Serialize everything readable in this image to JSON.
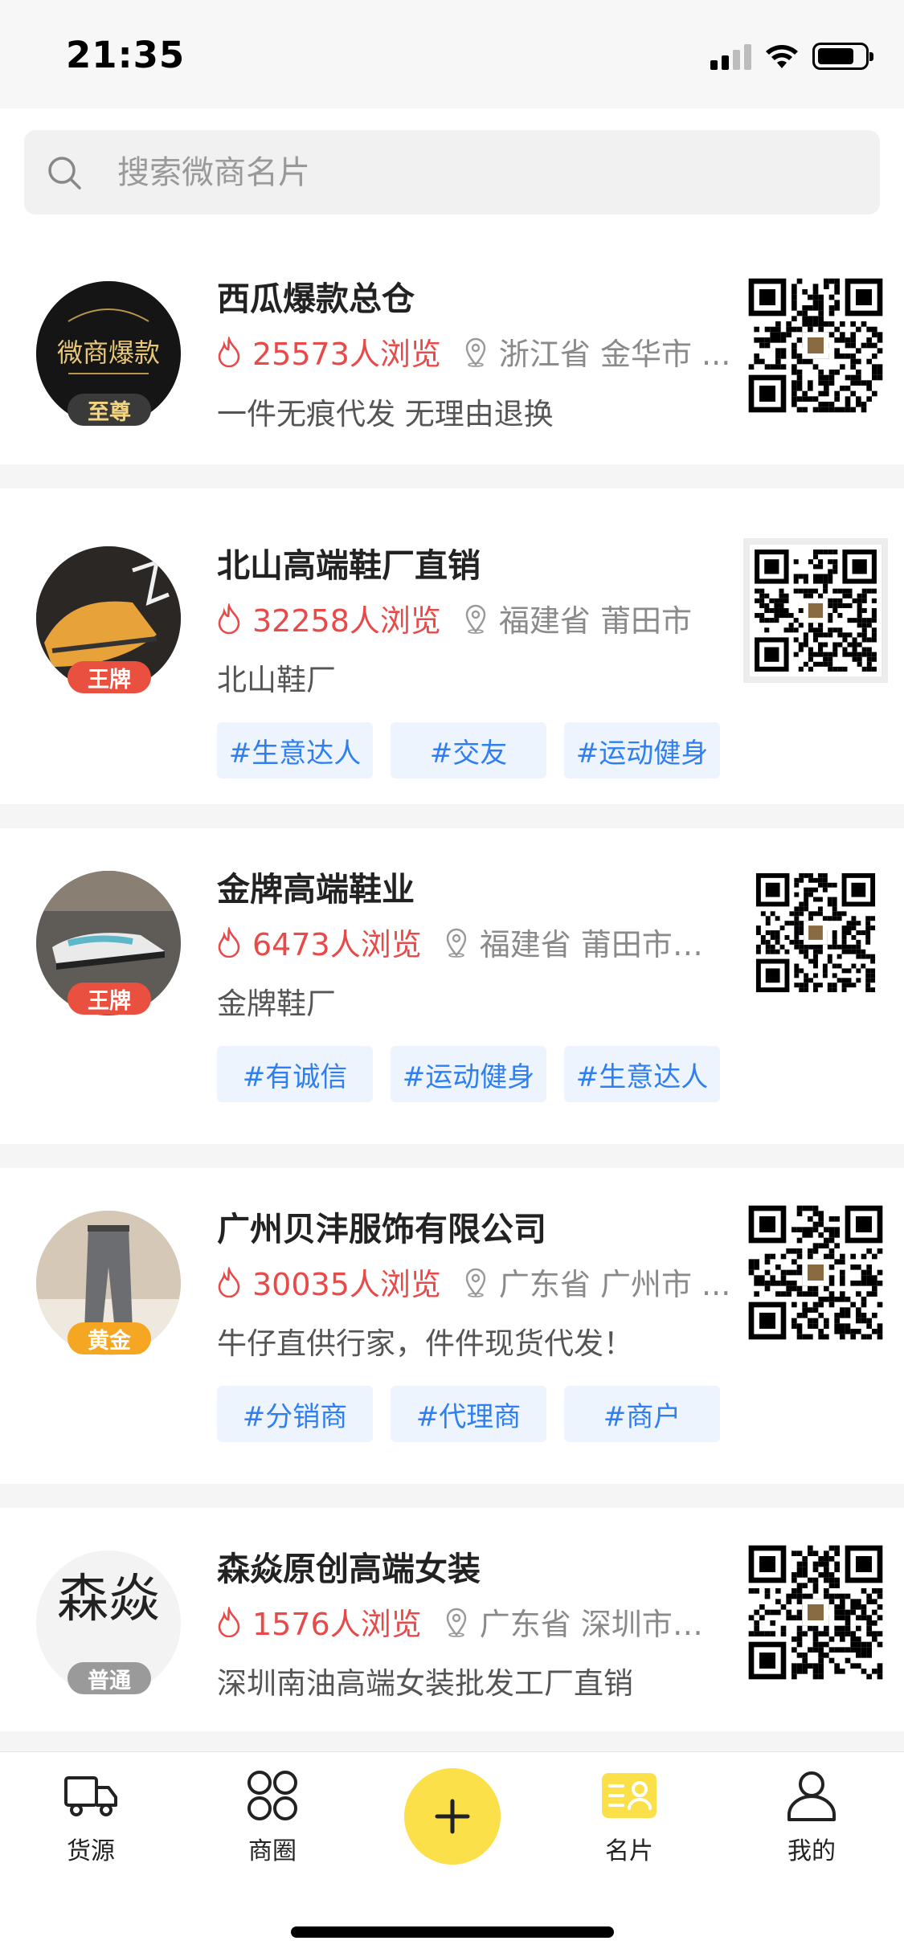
{
  "status": {
    "time": "21:35"
  },
  "search": {
    "placeholder": "搜索微商名片"
  },
  "cards": [
    {
      "name": "西瓜爆款总仓",
      "views": "25573人浏览",
      "location": "浙江省 金华市 ...",
      "desc": "一件无痕代发 无理由退换",
      "badge": "至尊",
      "avatar_text": "微商爆款",
      "tags": []
    },
    {
      "name": "北山高端鞋厂直销",
      "views": "32258人浏览",
      "location": "福建省 莆田市",
      "desc": "北山鞋厂",
      "badge": "王牌",
      "tags": [
        "#生意达人",
        "#交友",
        "#运动健身"
      ]
    },
    {
      "name": "金牌高端鞋业",
      "views": "6473人浏览",
      "location": "福建省 莆田市 ...",
      "desc": "金牌鞋厂",
      "badge": "王牌",
      "tags": [
        "#有诚信",
        "#运动健身",
        "#生意达人"
      ]
    },
    {
      "name": "广州贝沣服饰有限公司",
      "views": "30035人浏览",
      "location": "广东省 广州市 ...",
      "desc": "牛仔直供行家，件件现货代发！",
      "badge": "黄金",
      "tags": [
        "#分销商",
        "#代理商",
        "#商户"
      ]
    },
    {
      "name": "森焱原创高端女装",
      "views": "1576人浏览",
      "location": "广东省 深圳市 ...",
      "desc": "深圳南油高端女装批发工厂直销",
      "badge": "普通",
      "avatar_text": "森焱",
      "tags": []
    }
  ],
  "tabbar": {
    "items": [
      {
        "label": "货源",
        "icon": "truck-icon"
      },
      {
        "label": "商圈",
        "icon": "grid-icon"
      },
      {
        "label": "名片",
        "icon": "card-icon"
      },
      {
        "label": "我的",
        "icon": "user-icon"
      }
    ],
    "add_icon": "plus-icon"
  },
  "colors": {
    "accent_yellow": "#fbe04a",
    "views_red": "#e84a4a",
    "tag_blue": "#2f7ff0",
    "badge_zhizun": "#3a3a3a",
    "badge_wangpai": "#e9503f",
    "badge_huangjin": "#f5a623",
    "badge_putong": "#9a9a9a"
  }
}
